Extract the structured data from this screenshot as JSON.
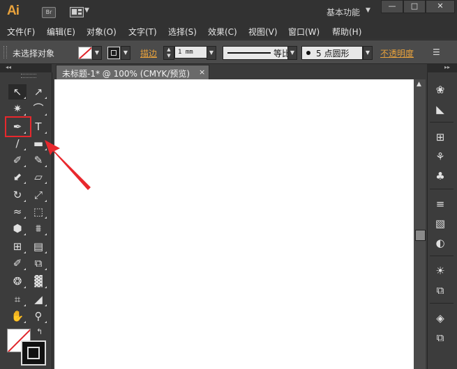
{
  "app": {
    "logo": "Ai",
    "bridge_label": "Br",
    "workspace": "基本功能",
    "window_buttons": [
      "—",
      "□",
      "✕"
    ]
  },
  "menubar": {
    "items": [
      "文件(F)",
      "编辑(E)",
      "对象(O)",
      "文字(T)",
      "选择(S)",
      "效果(C)",
      "视图(V)",
      "窗口(W)",
      "帮助(H)"
    ]
  },
  "controlbar": {
    "selection_status": "未选择对象",
    "stroke_label": "描边",
    "stroke_width": "1 mm",
    "profile": "等比",
    "brush": "5 点圆形",
    "opacity_label": "不透明度"
  },
  "document": {
    "tab_title": "未标题-1* @ 100% (CMYK/预览)",
    "close_glyph": "×"
  },
  "tools": [
    {
      "name": "selection-tool-icon",
      "glyph": "↖",
      "active": true
    },
    {
      "name": "direct-selection-tool-icon",
      "glyph": "↗"
    },
    {
      "name": "magic-wand-tool-icon",
      "glyph": "✷"
    },
    {
      "name": "lasso-tool-icon",
      "glyph": "⌒"
    },
    {
      "name": "pen-tool-icon",
      "glyph": "✒"
    },
    {
      "name": "type-tool-icon",
      "glyph": "T"
    },
    {
      "name": "line-segment-tool-icon",
      "glyph": "∕"
    },
    {
      "name": "rectangle-tool-icon",
      "glyph": "▬"
    },
    {
      "name": "paintbrush-tool-icon",
      "glyph": "✐"
    },
    {
      "name": "pencil-tool-icon",
      "glyph": "✎"
    },
    {
      "name": "blob-brush-tool-icon",
      "glyph": "⬋"
    },
    {
      "name": "eraser-tool-icon",
      "glyph": "▱"
    },
    {
      "name": "rotate-tool-icon",
      "glyph": "↻"
    },
    {
      "name": "scale-tool-icon",
      "glyph": "⤢"
    },
    {
      "name": "width-tool-icon",
      "glyph": "≈"
    },
    {
      "name": "free-transform-tool-icon",
      "glyph": "⬚"
    },
    {
      "name": "shape-builder-tool-icon",
      "glyph": "⬢"
    },
    {
      "name": "perspective-grid-tool-icon",
      "glyph": "⩩"
    },
    {
      "name": "mesh-tool-icon",
      "glyph": "⊞"
    },
    {
      "name": "gradient-tool-icon",
      "glyph": "▤"
    },
    {
      "name": "eyedropper-tool-icon",
      "glyph": "✐"
    },
    {
      "name": "blend-tool-icon",
      "glyph": "⧉"
    },
    {
      "name": "symbol-sprayer-tool-icon",
      "glyph": "❂"
    },
    {
      "name": "column-graph-tool-icon",
      "glyph": "▓"
    },
    {
      "name": "artboard-tool-icon",
      "glyph": "⌗"
    },
    {
      "name": "slice-tool-icon",
      "glyph": "◢"
    },
    {
      "name": "hand-tool-icon",
      "glyph": "✋"
    },
    {
      "name": "zoom-tool-icon",
      "glyph": "⚲"
    }
  ],
  "right_panel": [
    {
      "name": "color-panel-icon",
      "glyph": "❀"
    },
    {
      "name": "color-guide-icon",
      "glyph": "◣"
    },
    {
      "name": "swatches-panel-icon",
      "glyph": "⊞"
    },
    {
      "name": "brushes-panel-icon",
      "glyph": "⚘"
    },
    {
      "name": "symbols-panel-icon",
      "glyph": "♣"
    },
    {
      "name": "stroke-panel-icon",
      "glyph": "≡"
    },
    {
      "name": "gradient-panel-icon",
      "glyph": "▧"
    },
    {
      "name": "transparency-panel-icon",
      "glyph": "◐"
    },
    {
      "name": "appearance-panel-icon",
      "glyph": "☀"
    },
    {
      "name": "graphic-styles-panel-icon",
      "glyph": "⧉"
    },
    {
      "name": "layers-panel-icon",
      "glyph": "◈"
    },
    {
      "name": "artboards-panel-icon",
      "glyph": "⧉"
    }
  ],
  "colors": {
    "accent_orange": "#e8a23c",
    "highlight_red": "#e8282d",
    "canvas_white": "#ffffff",
    "ui_dark": "#323232"
  }
}
